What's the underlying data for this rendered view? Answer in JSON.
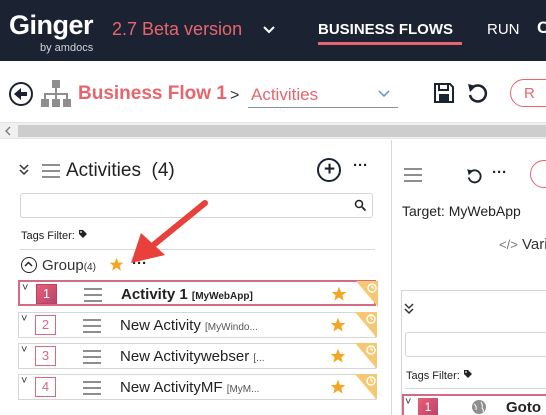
{
  "app": {
    "logo": "Ginger",
    "logo_sub": "by amdocs",
    "version": "2.7 Beta version",
    "nav": {
      "business_flows": "BUSINESS FLOWS",
      "run": "RUN",
      "cut_letter": "C"
    }
  },
  "breadcrumb": {
    "flow_name": "Business Flow 1",
    "separator": ">",
    "section": "Activities"
  },
  "toolbar": {
    "pill_label": "R"
  },
  "activities_panel": {
    "title": "Activities",
    "count": "(4)",
    "tags_filter_label": "Tags Filter:",
    "group": {
      "name": "Group",
      "count": "(4)"
    },
    "rows": [
      {
        "num": "1",
        "name": "Activity 1",
        "app": "[MyWebApp]",
        "selected": true
      },
      {
        "num": "2",
        "name": "New Activity",
        "app": "[MyWindo...",
        "selected": false
      },
      {
        "num": "3",
        "name": "New Activitywebser",
        "app": "[...",
        "selected": false
      },
      {
        "num": "4",
        "name": "New ActivityMF",
        "app": "[MyM...",
        "selected": false
      }
    ]
  },
  "right_panel": {
    "target": "Target: MyWebApp",
    "variables_label": "Vari",
    "tags_filter_label": "Tags Filter:",
    "row": {
      "num": "1",
      "name": "Goto U"
    }
  },
  "colors": {
    "brand_red": "#e8656d",
    "header_bg": "#1b2332",
    "star": "#f4a623",
    "arrow": "#e8403a",
    "selection": "#d46b83"
  },
  "icons": [
    "back-arrow-icon",
    "flow-hierarchy-icon",
    "chevron-down-icon",
    "save-icon",
    "undo-icon",
    "double-chevron-icon",
    "hamburger-icon",
    "plus-icon",
    "more-dots-icon",
    "search-icon",
    "tag-icon",
    "collapse-circle-icon",
    "star-icon",
    "corner-flag-icon",
    "code-icon",
    "globe-icon"
  ]
}
